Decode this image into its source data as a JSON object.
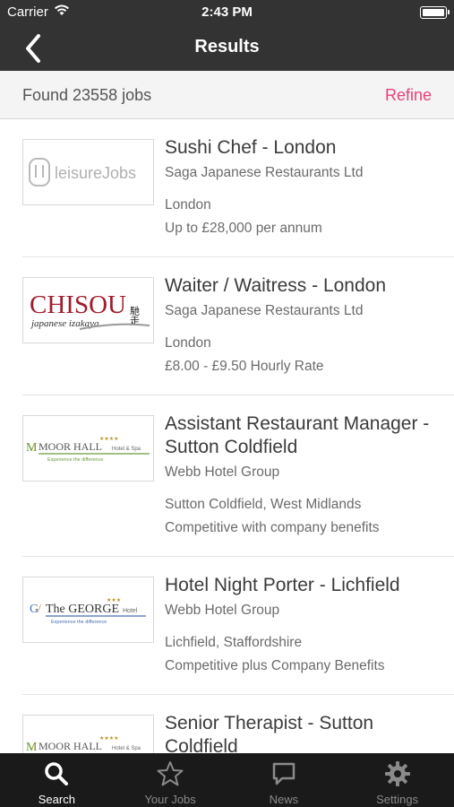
{
  "status_bar": {
    "carrier": "Carrier",
    "time": "2:43 PM"
  },
  "nav": {
    "title": "Results",
    "back_icon": "chevron-left-icon"
  },
  "summary": {
    "found_text": "Found 23558 jobs",
    "refine_label": "Refine"
  },
  "colors": {
    "accent": "#e8407a",
    "nav_bg": "#333333",
    "tab_bg": "#1a1a1a"
  },
  "jobs": [
    {
      "logo": {
        "type": "leisurejobs",
        "text": "leisureJobs"
      },
      "title": "Sushi Chef - London",
      "company": "Saga Japanese Restaurants Ltd",
      "location": "London",
      "salary": "Up to £28,000 per annum"
    },
    {
      "logo": {
        "type": "chisou",
        "text": "CHISOU",
        "kanji": "馳走",
        "sub": "japanese izakaya"
      },
      "title": "Waiter / Waitress - London",
      "company": "Saga Japanese Restaurants Ltd",
      "location": "London",
      "salary": "£8.00 - £9.50 Hourly Rate"
    },
    {
      "logo": {
        "type": "moorhall",
        "text": "MOOR HALL",
        "suffix": "Hotel & Spa",
        "sub": "Experience the difference"
      },
      "title": "Assistant Restaurant Manager - Sutton Coldfield",
      "company": "Webb Hotel Group",
      "location": "Sutton Coldfield, West Midlands",
      "salary": "Competitive with company benefits"
    },
    {
      "logo": {
        "type": "george",
        "text": "The GEORGE",
        "suffix": "Hotel",
        "sub": "Experience the difference"
      },
      "title": "Hotel Night Porter - Lichfield",
      "company": "Webb Hotel Group",
      "location": "Lichfield, Staffordshire",
      "salary": "Competitive plus Company Benefits"
    },
    {
      "logo": {
        "type": "moorhall",
        "text": "MOOR HALL",
        "suffix": "Hotel & Spa",
        "sub": ""
      },
      "title": "Senior Therapist - Sutton Coldfield",
      "company": "",
      "location": "",
      "salary": ""
    }
  ],
  "tabs": [
    {
      "label": "Search",
      "icon": "search-icon",
      "active": true
    },
    {
      "label": "Your Jobs",
      "icon": "star-icon",
      "active": false
    },
    {
      "label": "News",
      "icon": "chat-bubble-icon",
      "active": false
    },
    {
      "label": "Settings",
      "icon": "gear-icon",
      "active": false
    }
  ]
}
